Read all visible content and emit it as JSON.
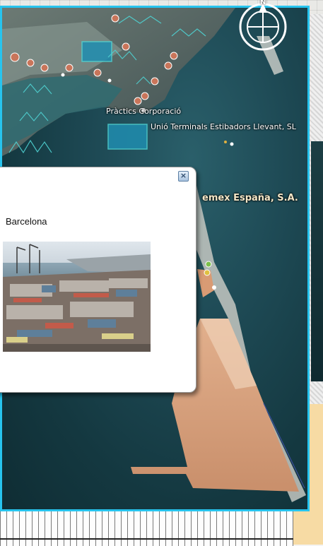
{
  "viewport": {
    "labels": {
      "practics": "Pràctics Corporació",
      "unio": "Unió Terminals Estibadors Llevant, SL",
      "cemex": "emex España, S.A."
    },
    "compass_north": "N"
  },
  "balloon": {
    "title": "Barcelona",
    "close_glyph": "×",
    "photo_subject": "container port aerial photo"
  },
  "colors": {
    "viewport_border": "#27c4ee",
    "water": "#1e4a55",
    "pier_fill": "#d8a27f",
    "marker": "#c9755a",
    "building": "#4fd1d1"
  },
  "icons": {
    "compass": "compass-icon",
    "close": "close-icon",
    "markers": "placemark-icon",
    "buildings": "3d-building-icon"
  }
}
